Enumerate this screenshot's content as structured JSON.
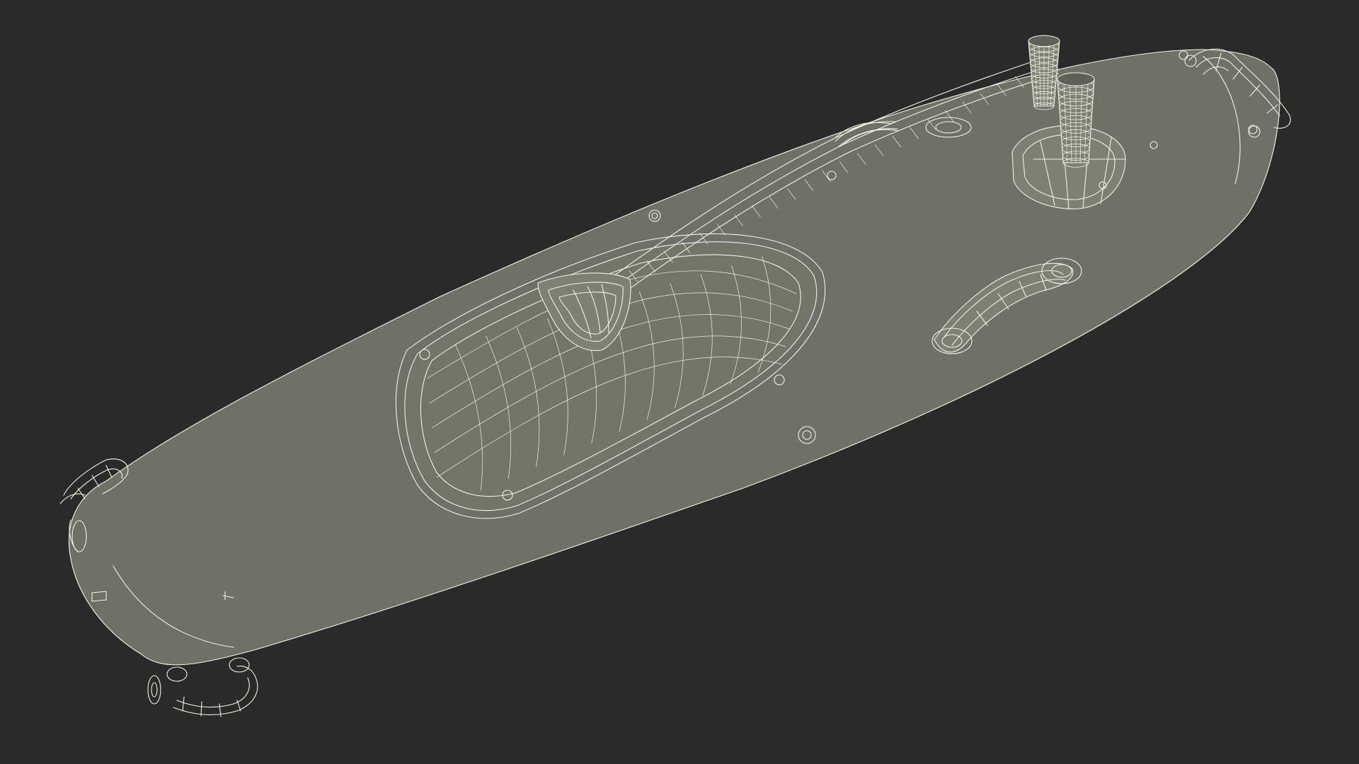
{
  "render": {
    "background_color": "#2a2a2a",
    "surface_color": "#6f7067",
    "wire_color": "#f2f2e6"
  },
  "object": {
    "components": [
      "hull-icon",
      "cockpit-rim-icon",
      "paddle-icon",
      "rod-holder-icon",
      "carry-handle-icon",
      "bow-handle-icon",
      "stern-handle-icon",
      "deck-fitting-icon"
    ]
  }
}
